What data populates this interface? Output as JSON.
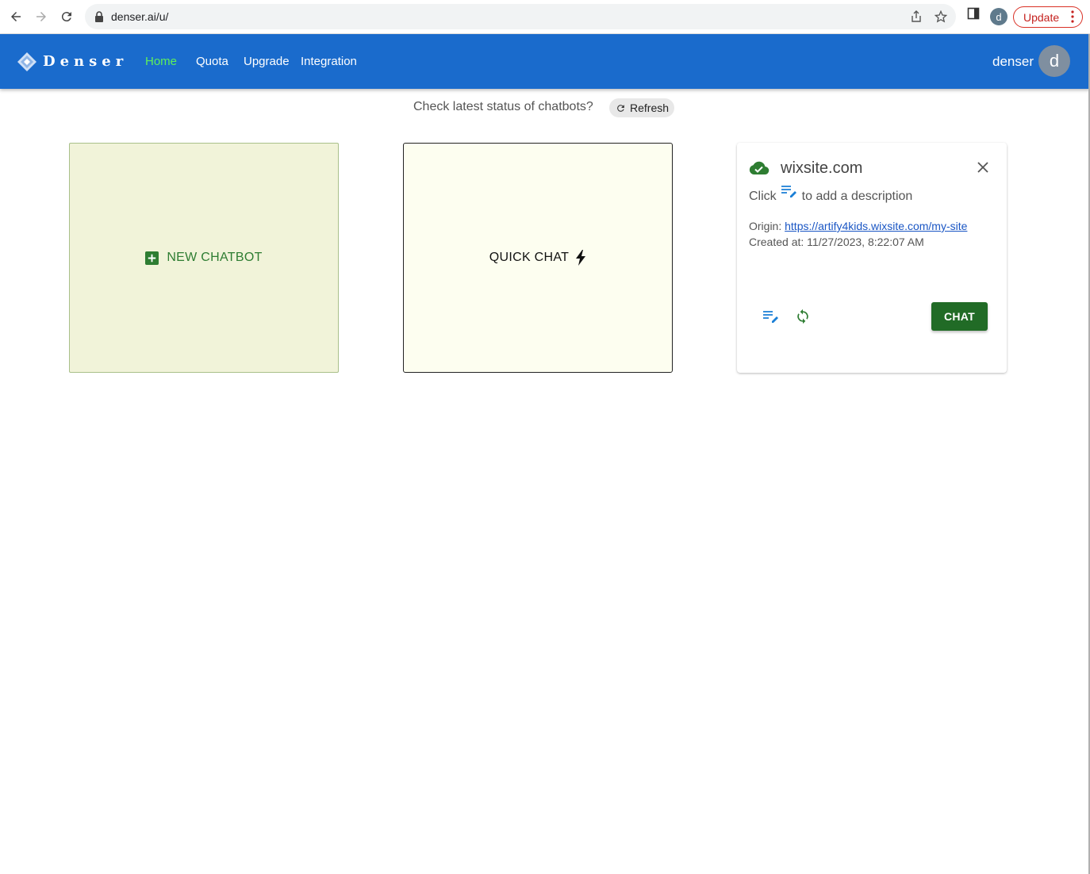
{
  "browser": {
    "url": "denser.ai/u/",
    "profile_initial": "d",
    "update_label": "Update"
  },
  "header": {
    "brand": "Denser",
    "nav": [
      {
        "label": "Home",
        "active": true
      },
      {
        "label": "Quota",
        "active": false
      },
      {
        "label": "Upgrade",
        "active": false
      },
      {
        "label": "Integration",
        "active": false
      }
    ],
    "user_name": "denser",
    "avatar_initial": "d"
  },
  "status": {
    "question": "Check latest status of chatbots?",
    "refresh_label": "Refresh"
  },
  "cards": {
    "new_chatbot_label": "NEW CHATBOT",
    "quick_chat_label": "QUICK CHAT"
  },
  "chatbot": {
    "title": "wixsite.com",
    "desc_prefix": "Click",
    "desc_suffix": "to add a description",
    "origin_label": "Origin:",
    "origin_url": "https://artify4kids.wixsite.com/my-site",
    "created_label": "Created at:",
    "created_value": "11/27/2023, 8:22:07 AM",
    "chat_label": "CHAT"
  },
  "colors": {
    "app_bar": "#1a6bcc",
    "nav_active": "#5ff05a",
    "chat_button": "#216b26",
    "new_card_bg": "#f1f3d9",
    "quick_card_bg": "#fdfef0"
  },
  "icons": [
    "back-icon",
    "forward-icon",
    "reload-icon",
    "lock-icon",
    "share-icon",
    "star-icon",
    "sidepanel-icon",
    "more-icon",
    "logo-icon",
    "refresh-icon",
    "add-box-icon",
    "bolt-icon",
    "cloud-done-icon",
    "close-icon",
    "edit-note-icon",
    "sync-icon"
  ]
}
